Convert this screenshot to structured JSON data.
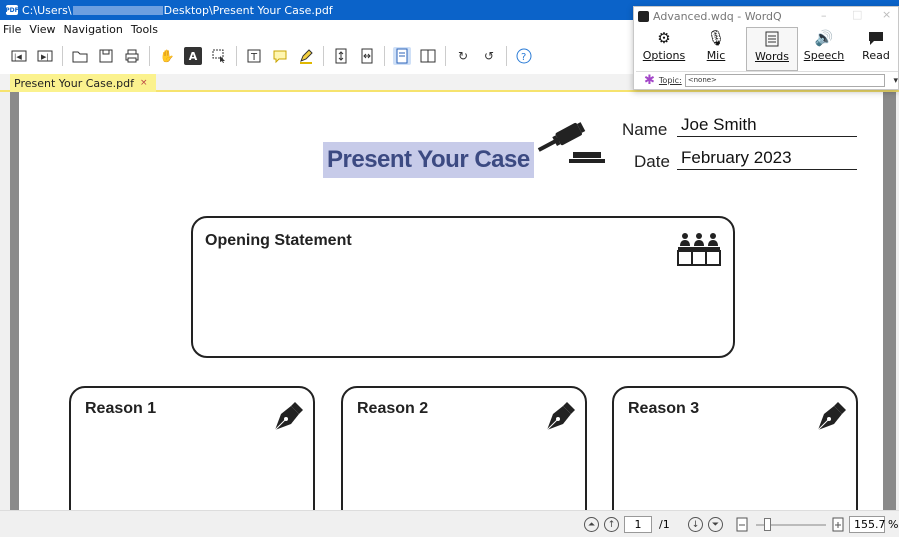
{
  "window": {
    "path_prefix": "C:\\Users\\",
    "path_suffix": "Desktop\\Present Your Case.pdf"
  },
  "menu": [
    "File",
    "View",
    "Navigation",
    "Tools"
  ],
  "tab": {
    "label": "Present Your Case.pdf",
    "close": "×"
  },
  "document": {
    "title": "Present Your Case",
    "name_label": "Name",
    "name_value": "Joe Smith",
    "date_label": "Date",
    "date_value": "February 2023",
    "opening_statement": "Opening Statement",
    "reasons": [
      "Reason 1",
      "Reason 2",
      "Reason 3"
    ]
  },
  "status": {
    "page_current": "1",
    "page_total": "/1",
    "zoom": "155.7",
    "zoom_unit": "%"
  },
  "wordq": {
    "title": "Advanced.wdq - WordQ",
    "buttons": [
      "Options",
      "Mic",
      "Words",
      "Speech",
      "Read"
    ],
    "topic_label": "Topic:",
    "topic_value": "<none>",
    "win_controls": [
      "–",
      "□",
      "×"
    ]
  },
  "colors": {
    "titlebar": "#0b63c9",
    "tab": "#fbf28e",
    "title_highlight": "#c7cbe9",
    "title_text": "#3c4a82"
  }
}
